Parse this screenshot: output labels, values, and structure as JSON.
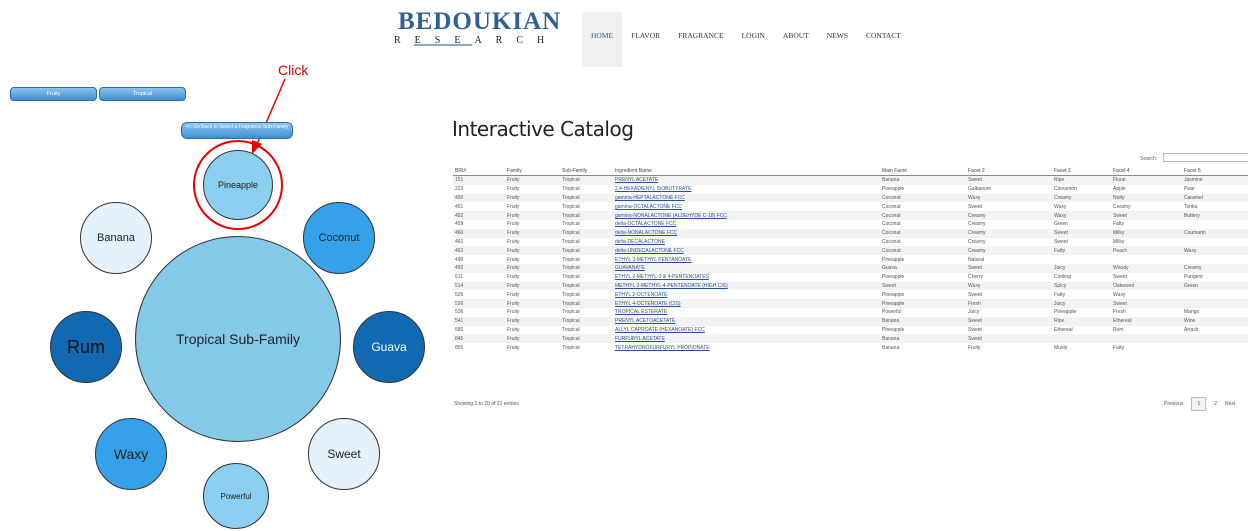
{
  "header": {
    "logo_main": "BEDOUKIAN",
    "logo_sub": "RESEARCH",
    "nav": [
      "HOME",
      "FLAVOR",
      "FRAGRANCE",
      "LOGIN",
      "ABOUT",
      "NEWS",
      "CONTACT"
    ]
  },
  "annotation": {
    "label": "Click"
  },
  "filters": {
    "family": "Fruity",
    "subfamily": "Tropical"
  },
  "go_back": "<< Go Back to Select a Fragrance Sub-Family",
  "bubbles": {
    "center": "Tropical Sub-Family",
    "pineapple": "Pineapple",
    "banana": "Banana",
    "coconut": "Coconut",
    "rum": "Rum",
    "guava": "Guava",
    "waxy": "Waxy",
    "sweet": "Sweet",
    "powerful": "Powerful"
  },
  "catalog": {
    "title": "Interactive Catalog",
    "search_label": "Search:",
    "columns": [
      "BRI#",
      "Family",
      "Sub-Family",
      "Ingredient Name",
      "Main Facet",
      "Facet 2",
      "Facet 3",
      "Facet 4",
      "Facet 5"
    ],
    "rows": [
      [
        "151",
        "Fruity",
        "Tropical",
        "PRENYL ACETATE",
        "Banana",
        "Sweet",
        "Ripe",
        "Floral",
        "Jasmine"
      ],
      [
        "223",
        "Fruity",
        "Tropical",
        "2,4-HEXADIENYL ISOBUTYRATE",
        "Pineapple",
        "Galbanum",
        "Cinnamon",
        "Apple",
        "Pear"
      ],
      [
        "450",
        "Fruity",
        "Tropical",
        "gamma-HEPTALACTONE FCC",
        "Coconut",
        "Waxy",
        "Creamy",
        "Nutty",
        "Caramel"
      ],
      [
        "451",
        "Fruity",
        "Tropical",
        "gamma-OCTALACTONE FCC",
        "Coconut",
        "Sweet",
        "Waxy",
        "Creamy",
        "Tonka"
      ],
      [
        "452",
        "Fruity",
        "Tropical",
        "gamma-NONALACTONE (ALDEHYDE C-18) FCC",
        "Coconut",
        "Creamy",
        "Waxy",
        "Sweet",
        "Buttery"
      ],
      [
        "459",
        "Fruity",
        "Tropical",
        "delta-OCTALACTONE FCC",
        "Coconut",
        "Creamy",
        "Green",
        "Fatty",
        ""
      ],
      [
        "460",
        "Fruity",
        "Tropical",
        "delta-NONALACTONE FCC",
        "Coconut",
        "Creamy",
        "Sweet",
        "Milky",
        "Coumarin"
      ],
      [
        "461",
        "Fruity",
        "Tropical",
        "delta-DECALACTONE",
        "Coconut",
        "Creamy",
        "Sweet",
        "Milky",
        ""
      ],
      [
        "462",
        "Fruity",
        "Tropical",
        "delta-UNDECALACTONE FCC",
        "Coconut",
        "Creamy",
        "Fatty",
        "Peach",
        "Waxy"
      ],
      [
        "490",
        "Fruity",
        "Tropical",
        "ETHYL 3-METHYL PENTANOATE",
        "Pineapple",
        "Natural",
        "",
        "",
        ""
      ],
      [
        "493",
        "Fruity",
        "Tropical",
        "GUAVANATE",
        "Guava",
        "Sweet",
        "Juicy",
        "Woody",
        "Creamy"
      ],
      [
        "511",
        "Fruity",
        "Tropical",
        "ETHYL 2-METHYL-3 & 4-PENTENOATES",
        "Pineapple",
        "Cherry",
        "Cooling",
        "Sweet",
        "Pungent"
      ],
      [
        "514",
        "Fruity",
        "Tropical",
        "METHYL 2-METHYL-4-PENTENOATE (HIGH CIS)",
        "Sweet",
        "Waxy",
        "Spicy",
        "Oakwood",
        "Green"
      ],
      [
        "525",
        "Fruity",
        "Tropical",
        "ETHYL 2-OCTENOATE",
        "Pineapple",
        "Sweet",
        "Fatty",
        "Waxy",
        ""
      ],
      [
        "526",
        "Fruity",
        "Tropical",
        "ETHYL 4-OCTENOATE (CIS)",
        "Pineapple",
        "Fresh",
        "Juicy",
        "Sweet",
        ""
      ],
      [
        "536",
        "Fruity",
        "Tropical",
        "TROPICAL ESTERATE",
        "Powerful",
        "Juicy",
        "Pineapple",
        "Fresh",
        "Mango"
      ],
      [
        "541",
        "Fruity",
        "Tropical",
        "PRENYL ACETOACETATE",
        "Banana",
        "Sweet",
        "Ripe",
        "Ethereal",
        "Wine"
      ],
      [
        "580",
        "Fruity",
        "Tropical",
        "ALLYL CAPROATE (HEXANOATE) FCC",
        "Pineapple",
        "Sweet",
        "Ethereal",
        "Rum",
        "Arrack"
      ],
      [
        "845",
        "Fruity",
        "Tropical",
        "FURFURYL ACETATE",
        "Banana",
        "Sweet",
        "",
        "",
        ""
      ],
      [
        "855",
        "Fruity",
        "Tropical",
        "TETRAHYDROFURFURYL PROPIONATE",
        "Banana",
        "Fruity",
        "Musty",
        "Fatty",
        ""
      ]
    ],
    "showing": "Showing 1 to 20 of 21 entries",
    "pager": {
      "previous": "Previous",
      "page1": "1",
      "page2": "2",
      "next": "Next"
    }
  },
  "colors": {
    "light": "#e3f2fb",
    "mid": "#8ccef0",
    "bright": "#35a1ea",
    "dark": "#1169b2",
    "center": "#84c9e8",
    "accent": "#e00000"
  }
}
